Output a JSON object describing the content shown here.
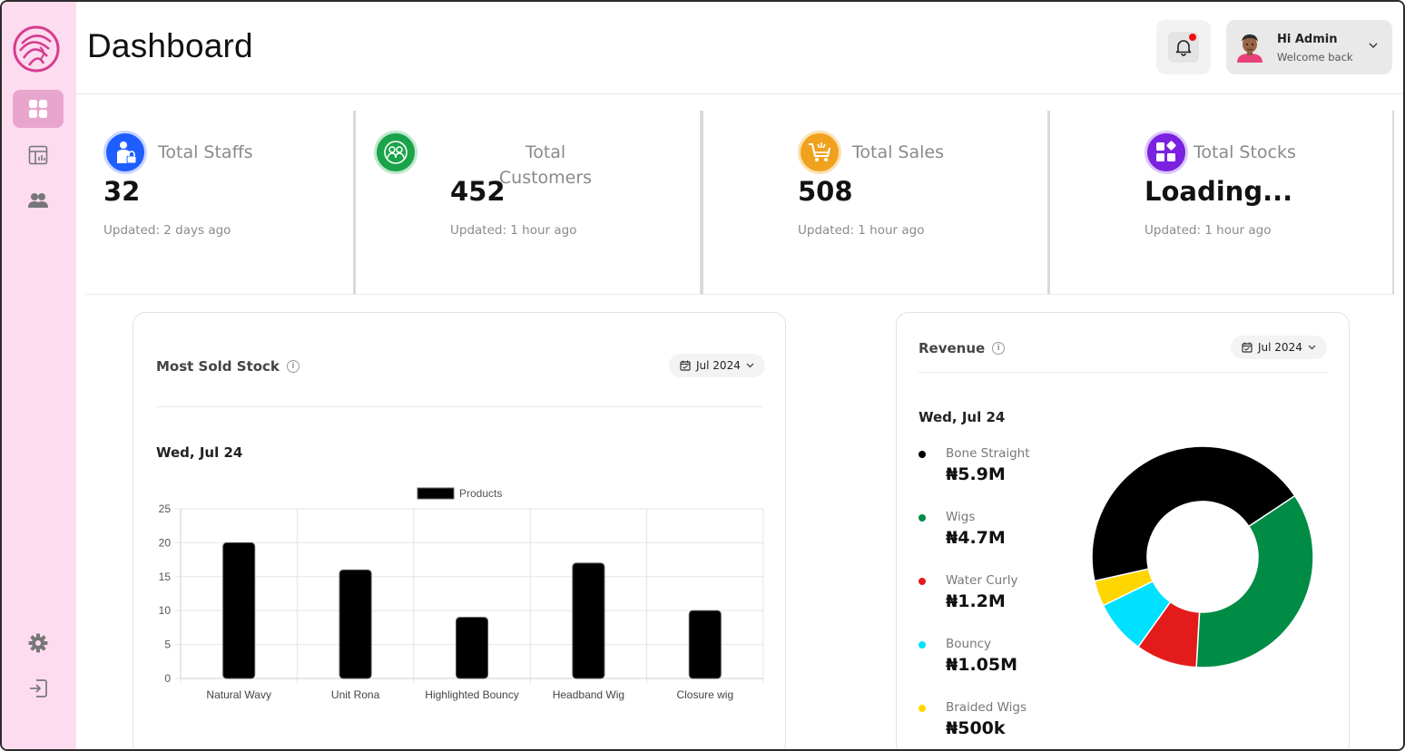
{
  "header": {
    "title": "Dashboard"
  },
  "user": {
    "greeting": "Hi Admin",
    "subtitle": "Welcome back"
  },
  "stats": [
    {
      "label": "Total Staffs",
      "value": "32",
      "updated": "Updated: 2 days ago",
      "color": "#1e5eff"
    },
    {
      "label": "Total Customers",
      "value": "452",
      "updated": "Updated: 1 hour ago",
      "color": "#1aa34a"
    },
    {
      "label": "Total Sales",
      "value": "508",
      "updated": "Updated: 1 hour ago",
      "color": "#f0a21e"
    },
    {
      "label": "Total Stocks",
      "value": "Loading...",
      "updated": "Updated: 1 hour ago",
      "color": "#7a22e0"
    }
  ],
  "most_sold": {
    "title": "Most Sold Stock",
    "period": "Jul 2024",
    "date": "Wed, Jul 24",
    "legend": "Products"
  },
  "revenue": {
    "title": "Revenue",
    "period": "Jul 2024",
    "date": "Wed, Jul 24",
    "items": [
      {
        "name": "Bone Straight",
        "value": "₦5.9M",
        "color": "#000000"
      },
      {
        "name": "Wigs",
        "value": "₦4.7M",
        "color": "#008c45"
      },
      {
        "name": "Water Curly",
        "value": "₦1.2M",
        "color": "#e31b1b"
      },
      {
        "name": "Bouncy",
        "value": "₦1.05M",
        "color": "#00e1ff"
      },
      {
        "name": "Braided Wigs",
        "value": "₦500k",
        "color": "#ffd600"
      }
    ]
  },
  "chart_data": [
    {
      "type": "bar",
      "title": "Most Sold Stock",
      "categories": [
        "Natural Wavy",
        "Unit Rona",
        "Highlighted Bouncy",
        "Headband Wig",
        "Closure wig"
      ],
      "series": [
        {
          "name": "Products",
          "values": [
            20,
            16,
            9,
            17,
            10
          ]
        }
      ],
      "ylim": [
        0,
        25
      ],
      "yticks": [
        0,
        5,
        10,
        15,
        20,
        25
      ],
      "grid": true,
      "legend": "top-center",
      "bar_color": "#000000"
    },
    {
      "type": "pie",
      "title": "Revenue",
      "categories": [
        "Bone Straight",
        "Wigs",
        "Water Curly",
        "Bouncy",
        "Braided Wigs"
      ],
      "values": [
        5.9,
        4.7,
        1.2,
        1.05,
        0.5
      ],
      "colors": [
        "#000000",
        "#008c45",
        "#e31b1b",
        "#00e1ff",
        "#ffd600"
      ],
      "donut": true
    }
  ]
}
